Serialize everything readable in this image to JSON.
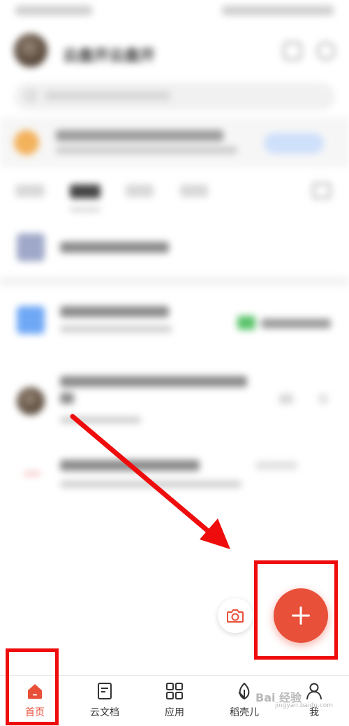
{
  "header": {
    "user_name": "云盘开云盘开"
  },
  "bottom_nav": {
    "items": [
      {
        "id": "home",
        "label": "首页",
        "icon": "home-icon",
        "active": true
      },
      {
        "id": "cloud-docs",
        "label": "云文档",
        "icon": "document-icon",
        "active": false
      },
      {
        "id": "apps",
        "label": "应用",
        "icon": "grid-icon",
        "active": false
      },
      {
        "id": "daoke",
        "label": "稻壳儿",
        "icon": "leaf-icon",
        "active": false
      },
      {
        "id": "me",
        "label": "我",
        "icon": "user-icon",
        "active": false
      }
    ]
  },
  "watermark": {
    "text": "Bai 经验",
    "sub": "jingyan.baidu.com"
  },
  "colors": {
    "accent": "#e8503a",
    "annotation_red": "#ee0c0c"
  }
}
